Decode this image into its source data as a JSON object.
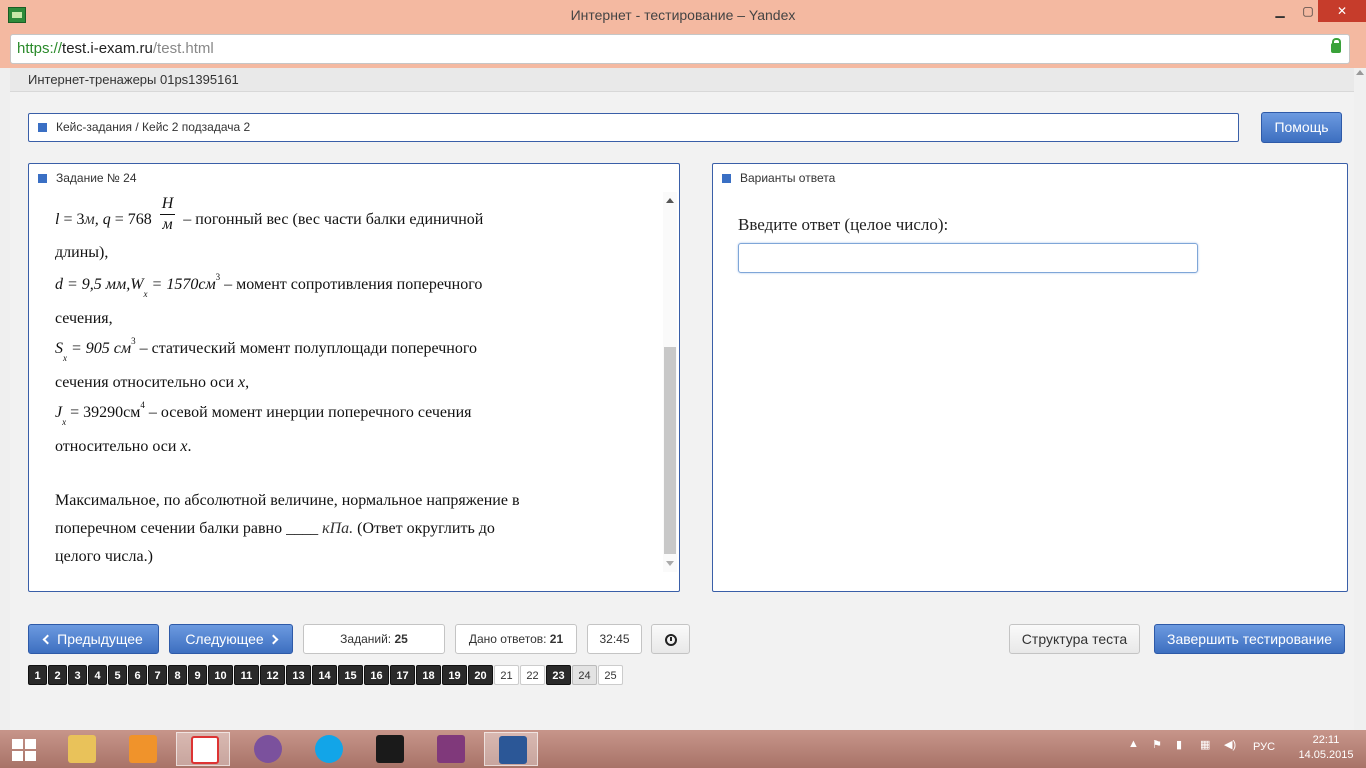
{
  "window": {
    "title": "Интернет - тестирование – Yandex"
  },
  "address": {
    "protocol": "https://",
    "host": "test.i-exam.ru",
    "path": "/test.html"
  },
  "page_header": "Интернет-тренажеры 01ps1395161",
  "breadcrumb": "Кейс-задания / Кейс 2 подзадача 2",
  "help_label": "Помощь",
  "task": {
    "heading": "Задание № 24",
    "lines": {
      "l_lhs": "l",
      "l_eq": " = 3",
      "l_unit": "м",
      "q_lhs": ", q",
      "q_eq": " = 768",
      "q_num": "Н",
      "q_den": "м",
      "l1_text": " – погонный вес (вес части балки единичной",
      "l2_text": "длины),",
      "d_expr": "d = 9,5 мм,W",
      "d_sub": "x",
      "d_eq": " = 1570см",
      "d_sup": "3",
      "l3_text": " – момент сопротивления поперечного",
      "l4_text": "сечения,",
      "s_lhs": "S",
      "s_sub": "x",
      "s_eq": " = 905 см",
      "s_sup": "3",
      "l5_text": " – статический момент полуплощади поперечного",
      "l6_text": "сечения относительно оси ",
      "l6_x": "x",
      "l6_tail": ",",
      "j_lhs": "J",
      "j_sub": "x",
      "j_eq": " = 39290см",
      "j_sup": "4",
      "l7_text": " – осевой момент инерции поперечного сечения",
      "l8_text": "относительно оси ",
      "l8_x": "x",
      "l8_tail": ".",
      "q1": "Максимальное, по абсолютной величине, нормальное напряжение в",
      "q2_a": "поперечном сечении балки равно ____ ",
      "q2_unit": "кПа.",
      "q2_b": " (Ответ округлить до",
      "q3": "целого числа.)"
    }
  },
  "answer": {
    "heading": "Варианты ответа",
    "label": "Введите ответ (целое число):",
    "value": ""
  },
  "nav": {
    "prev": "Предыдущее",
    "next": "Следующее",
    "tasks_label": "Заданий:",
    "tasks_count": "25",
    "answers_label": "Дано ответов:",
    "answers_count": "21",
    "timer": "32:45",
    "structure": "Структура теста",
    "finish": "Завершить тестирование"
  },
  "pager": [
    {
      "n": "1",
      "state": "done"
    },
    {
      "n": "2",
      "state": "done"
    },
    {
      "n": "3",
      "state": "done"
    },
    {
      "n": "4",
      "state": "done"
    },
    {
      "n": "5",
      "state": "done"
    },
    {
      "n": "6",
      "state": "done"
    },
    {
      "n": "7",
      "state": "done"
    },
    {
      "n": "8",
      "state": "done"
    },
    {
      "n": "9",
      "state": "done"
    },
    {
      "n": "10",
      "state": "done"
    },
    {
      "n": "11",
      "state": "done"
    },
    {
      "n": "12",
      "state": "done"
    },
    {
      "n": "13",
      "state": "done"
    },
    {
      "n": "14",
      "state": "done"
    },
    {
      "n": "15",
      "state": "done"
    },
    {
      "n": "16",
      "state": "done"
    },
    {
      "n": "17",
      "state": "done"
    },
    {
      "n": "18",
      "state": "done"
    },
    {
      "n": "19",
      "state": "done"
    },
    {
      "n": "20",
      "state": "done"
    },
    {
      "n": "21",
      "state": "todo"
    },
    {
      "n": "22",
      "state": "todo"
    },
    {
      "n": "23",
      "state": "done"
    },
    {
      "n": "24",
      "state": "current"
    },
    {
      "n": "25",
      "state": "todo"
    }
  ],
  "taskbar": {
    "apps": [
      "file-explorer-icon",
      "odnoklassniki-icon",
      "yandex-browser-icon",
      "viber-icon",
      "skype-icon",
      "galaxy-game-icon",
      "onenote-icon",
      "word-icon"
    ],
    "lang": "РУС",
    "time": "22:11",
    "date": "14.05.2015"
  },
  "colors": {
    "titlebar": "#f4b9a1",
    "accent": "#3a6fc4",
    "panel_border": "#3a5fa8",
    "taskbar": "#b9857a"
  }
}
